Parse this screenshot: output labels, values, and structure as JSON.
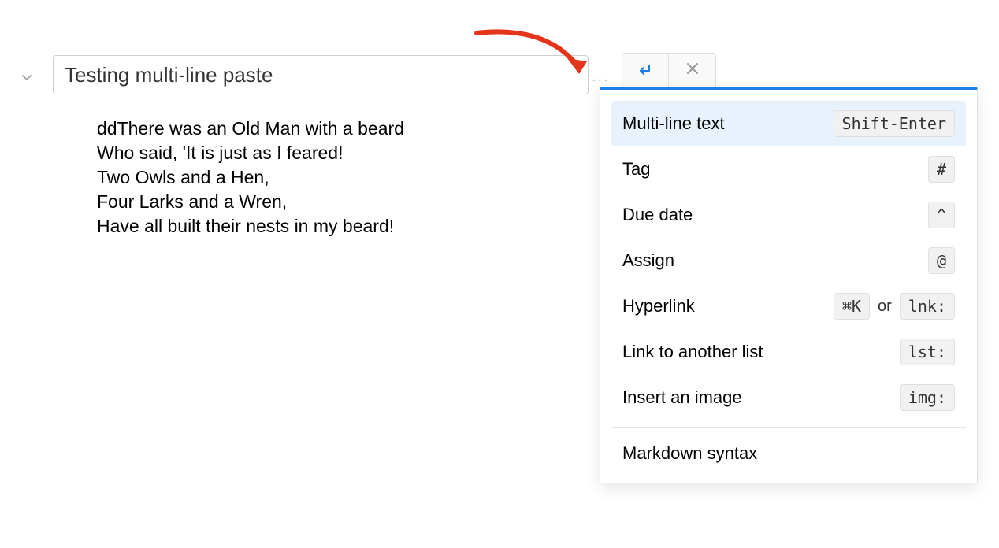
{
  "title": {
    "value": "Testing multi-line paste"
  },
  "ellipsis": "...",
  "content": "ddThere was an Old Man with a beard\nWho said, 'It is just as I feared!\nTwo Owls and a Hen,\nFour Larks and a Wren,\nHave all built their nests in my beard!",
  "panel": {
    "items": [
      {
        "label": "Multi-line text",
        "shortcuts": [
          "Shift-Enter"
        ],
        "selected": true
      },
      {
        "label": "Tag",
        "shortcuts": [
          "#"
        ]
      },
      {
        "label": "Due date",
        "shortcuts": [
          "^"
        ]
      },
      {
        "label": "Assign",
        "shortcuts": [
          "@"
        ]
      },
      {
        "label": "Hyperlink",
        "shortcuts": [
          "⌘K",
          "lnk:"
        ],
        "sep": "or"
      },
      {
        "label": "Link to another list",
        "shortcuts": [
          "lst:"
        ]
      },
      {
        "label": "Insert an image",
        "shortcuts": [
          "img:"
        ]
      }
    ],
    "footer": "Markdown syntax"
  }
}
